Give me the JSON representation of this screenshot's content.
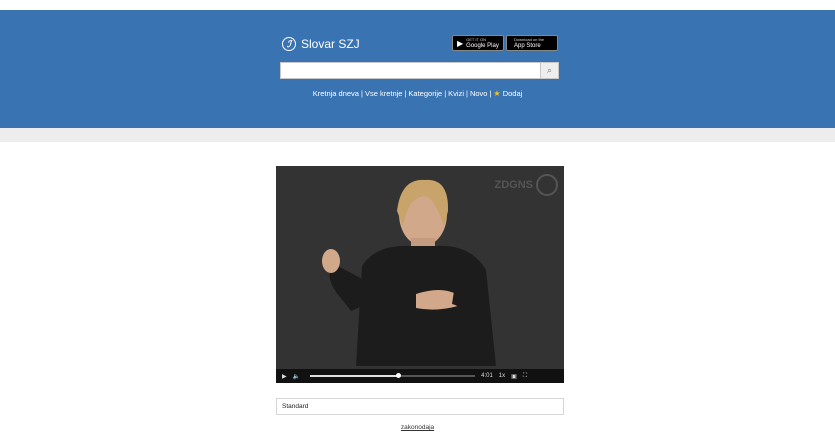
{
  "header": {
    "brand": "Slovar SZJ",
    "search": {
      "value": "",
      "placeholder": ""
    },
    "stores": [
      {
        "line1": "GET IT ON",
        "line2": "Google Play"
      },
      {
        "line1": "Download on the",
        "line2": "App Store"
      }
    ],
    "nav": [
      "Kretnja dneva",
      "Vse kretnje",
      "Kategorije",
      "Kvizi",
      "Novo",
      "Dodaj"
    ],
    "separator": "|"
  },
  "video": {
    "watermark": "ZDGNS",
    "progress": 0.53,
    "speed": "1x",
    "time": "4:01"
  },
  "select": {
    "value": "Standard"
  },
  "footer_link": "zakonodaja",
  "colors": {
    "header": "#3a73b2",
    "star": "#f3c613"
  }
}
